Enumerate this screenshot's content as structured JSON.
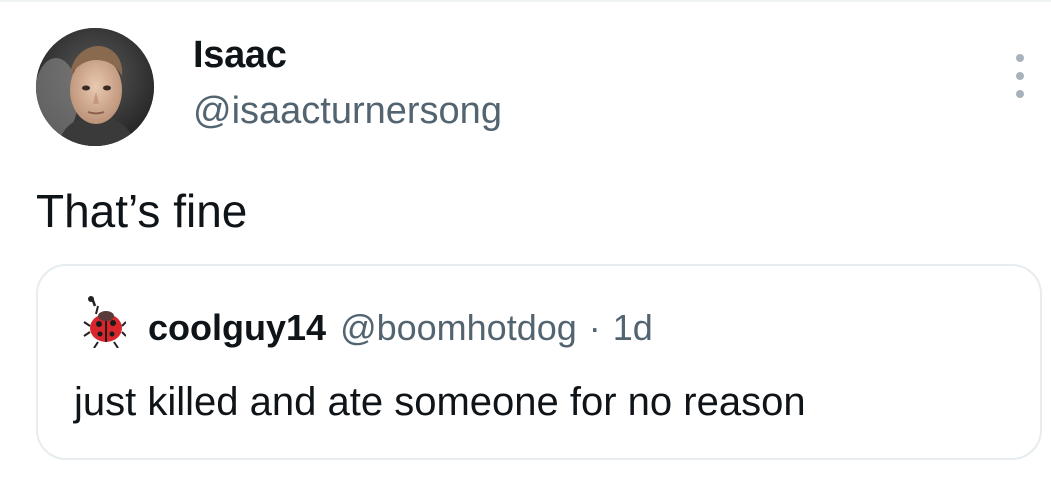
{
  "tweet": {
    "author": {
      "name": "Isaac",
      "handle": "@isaacturnersong"
    },
    "text": "That’s fine",
    "more_icon": "more-vertical-icon"
  },
  "quoted": {
    "author": {
      "name": "coolguy14",
      "handle": "@boomhotdog"
    },
    "separator": "·",
    "time": "1d",
    "text": "just killed and ate someone for no reason"
  },
  "colors": {
    "primary_text": "#0f1419",
    "secondary_text": "#536471",
    "border": "#e6ecef"
  }
}
